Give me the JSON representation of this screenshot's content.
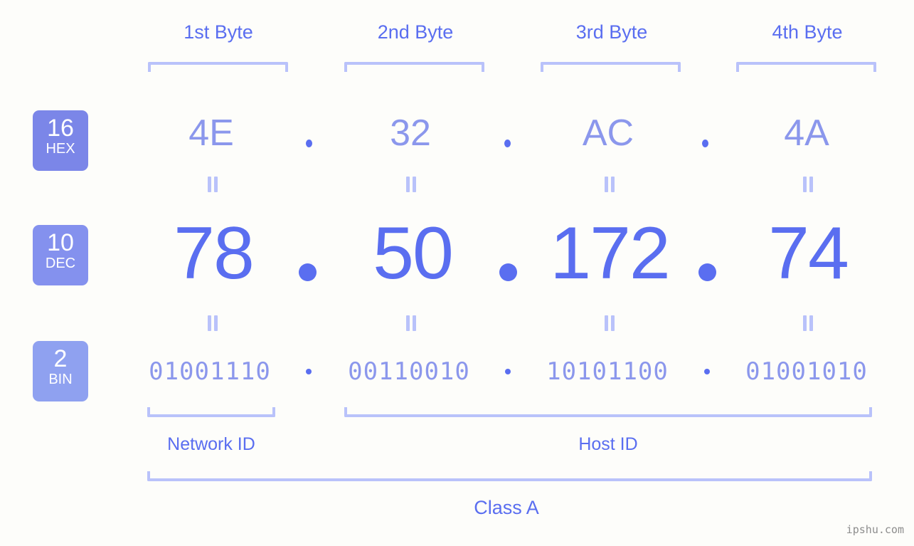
{
  "background": "#fdfdfa",
  "accent_strong": "#5a6ef0",
  "accent_light": "#8b97ec",
  "accent_pale": "#b9c2fa",
  "headers": [
    {
      "label": "1st Byte"
    },
    {
      "label": "2nd Byte"
    },
    {
      "label": "3rd Byte"
    },
    {
      "label": "4th Byte"
    }
  ],
  "rows": {
    "hex": {
      "badge_number": "16",
      "badge_label": "HEX",
      "badge_color": "#7b86e8",
      "values": [
        "4E",
        "32",
        "AC",
        "4A"
      ],
      "separator": "."
    },
    "dec": {
      "badge_number": "10",
      "badge_label": "DEC",
      "badge_color": "#8491ee",
      "values": [
        "78",
        "50",
        "172",
        "74"
      ],
      "separator": "."
    },
    "bin": {
      "badge_number": "2",
      "badge_label": "BIN",
      "badge_color": "#8fa1f0",
      "values": [
        "01001110",
        "00110010",
        "10101100",
        "01001010"
      ],
      "separator": "."
    }
  },
  "equality_symbol": "=",
  "sections": [
    {
      "label": "Network ID"
    },
    {
      "label": "Host ID"
    }
  ],
  "class": {
    "label": "Class A"
  },
  "watermark": {
    "text": "ipshu.com"
  }
}
